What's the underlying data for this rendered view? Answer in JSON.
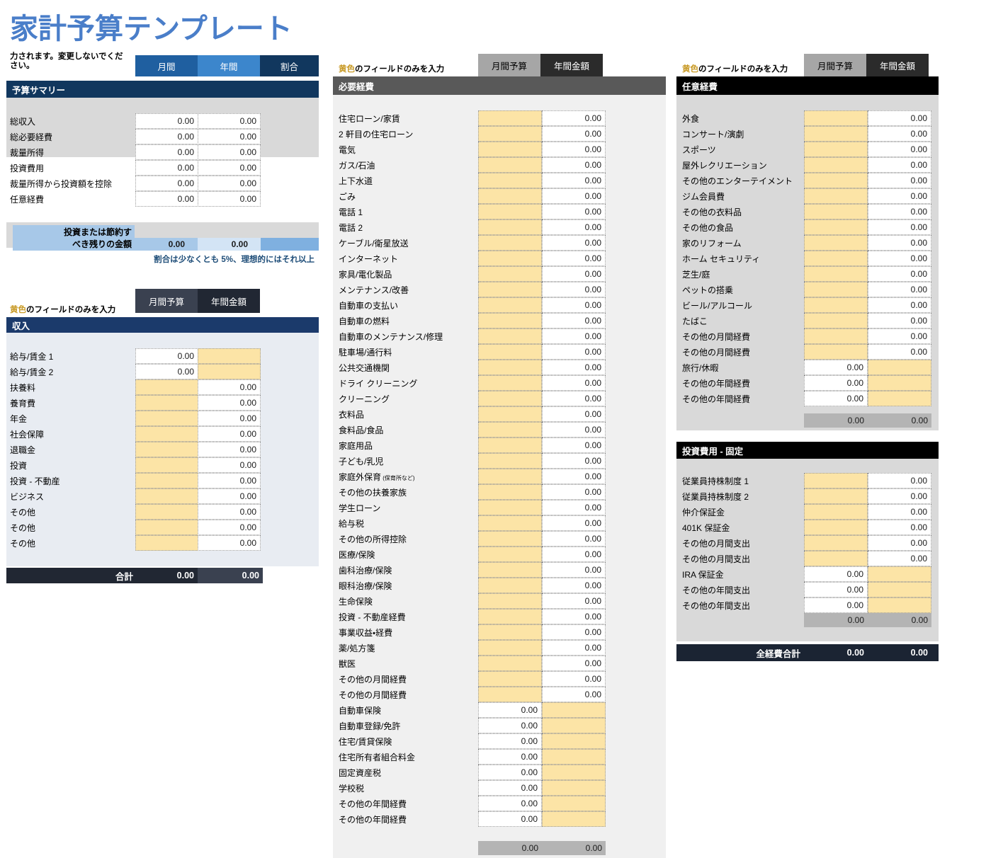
{
  "page": {
    "title": "家計予算テンプレート",
    "title_color": "#4a7ec9"
  },
  "summary": {
    "note": "力されます。変更しないでください。",
    "tabs": [
      {
        "label": "月間",
        "color": "#1f5fa0"
      },
      {
        "label": "年間",
        "color": "#3c86cc"
      },
      {
        "label": "割合",
        "color": "#11375e"
      }
    ],
    "section_title": "予算サマリー",
    "section_color": "#11375e",
    "rows": [
      {
        "label": "総収入",
        "monthly": "0.00",
        "annual": "0.00"
      },
      {
        "label": "総必要経費",
        "monthly": "0.00",
        "annual": "0.00"
      },
      {
        "label": "裁量所得",
        "monthly": "0.00",
        "annual": "0.00"
      },
      {
        "label": "投資費用",
        "monthly": "0.00",
        "annual": "0.00"
      },
      {
        "label": "裁量所得から投資額を控除",
        "monthly": "0.00",
        "annual": "0.00"
      },
      {
        "label": "任意経費",
        "monthly": "0.00",
        "annual": "0.00"
      }
    ],
    "remaining": {
      "label_line1": "投資または節約す",
      "label_line2": "べき残りの金額",
      "monthly": "0.00",
      "annual": "0.00"
    },
    "footnote": "割合は少なくとも 5%、理想的にはそれ以上"
  },
  "income": {
    "note_prefix": "黄色",
    "note_rest": "のフィールドのみを入力",
    "tabs": [
      {
        "label": "月間予算",
        "color": "#3a4150"
      },
      {
        "label": "年間金額",
        "color": "#212733"
      }
    ],
    "section_title": "収入",
    "section_color": "#1b3a6b",
    "rows": [
      {
        "label": "給与/賃金 1",
        "monthly": "0.00",
        "annual": "",
        "monthly_fill": "white",
        "annual_fill": "yellow"
      },
      {
        "label": "給与/賃金 2",
        "monthly": "0.00",
        "annual": "",
        "monthly_fill": "white",
        "annual_fill": "yellow"
      },
      {
        "label": "扶養料",
        "monthly": "",
        "annual": "0.00",
        "monthly_fill": "yellow",
        "annual_fill": "white"
      },
      {
        "label": "養育費",
        "monthly": "",
        "annual": "0.00",
        "monthly_fill": "yellow",
        "annual_fill": "white"
      },
      {
        "label": "年金",
        "monthly": "",
        "annual": "0.00",
        "monthly_fill": "yellow",
        "annual_fill": "white"
      },
      {
        "label": "社会保障",
        "monthly": "",
        "annual": "0.00",
        "monthly_fill": "yellow",
        "annual_fill": "white"
      },
      {
        "label": "退職金",
        "monthly": "",
        "annual": "0.00",
        "monthly_fill": "yellow",
        "annual_fill": "white"
      },
      {
        "label": "投資",
        "monthly": "",
        "annual": "0.00",
        "monthly_fill": "yellow",
        "annual_fill": "white"
      },
      {
        "label": "投資 - 不動産",
        "monthly": "",
        "annual": "0.00",
        "monthly_fill": "yellow",
        "annual_fill": "white"
      },
      {
        "label": "ビジネス",
        "monthly": "",
        "annual": "0.00",
        "monthly_fill": "yellow",
        "annual_fill": "white"
      },
      {
        "label": "その他",
        "monthly": "",
        "annual": "0.00",
        "monthly_fill": "yellow",
        "annual_fill": "white"
      },
      {
        "label": "その他",
        "monthly": "",
        "annual": "0.00",
        "monthly_fill": "yellow",
        "annual_fill": "white"
      },
      {
        "label": "その他",
        "monthly": "",
        "annual": "0.00",
        "monthly_fill": "yellow",
        "annual_fill": "white"
      }
    ],
    "total": {
      "label": "合計",
      "monthly": "0.00",
      "annual": "0.00"
    }
  },
  "necessary": {
    "note_prefix": "黄色",
    "note_rest": "のフィールドのみを入力",
    "tabs": [
      {
        "label": "月間予算",
        "color": "#a6a6a6"
      },
      {
        "label": "年間金額",
        "color": "#2b2b2b"
      }
    ],
    "section_title": "必要経費",
    "section_color": "#595959",
    "rows": [
      {
        "label": "住宅ローン/家賃",
        "monthly": "",
        "annual": "0.00",
        "monthly_fill": "yellow",
        "annual_fill": "white"
      },
      {
        "label": "2 軒目の住宅ローン",
        "monthly": "",
        "annual": "0.00",
        "monthly_fill": "yellow",
        "annual_fill": "white"
      },
      {
        "label": "電気",
        "monthly": "",
        "annual": "0.00",
        "monthly_fill": "yellow",
        "annual_fill": "white"
      },
      {
        "label": "ガス/石油",
        "monthly": "",
        "annual": "0.00",
        "monthly_fill": "yellow",
        "annual_fill": "white"
      },
      {
        "label": "上下水道",
        "monthly": "",
        "annual": "0.00",
        "monthly_fill": "yellow",
        "annual_fill": "white"
      },
      {
        "label": "ごみ",
        "monthly": "",
        "annual": "0.00",
        "monthly_fill": "yellow",
        "annual_fill": "white"
      },
      {
        "label": "電話 1",
        "monthly": "",
        "annual": "0.00",
        "monthly_fill": "yellow",
        "annual_fill": "white"
      },
      {
        "label": "電話 2",
        "monthly": "",
        "annual": "0.00",
        "monthly_fill": "yellow",
        "annual_fill": "white"
      },
      {
        "label": "ケーブル/衛星放送",
        "monthly": "",
        "annual": "0.00",
        "monthly_fill": "yellow",
        "annual_fill": "white"
      },
      {
        "label": "インターネット",
        "monthly": "",
        "annual": "0.00",
        "monthly_fill": "yellow",
        "annual_fill": "white"
      },
      {
        "label": "家具/電化製品",
        "monthly": "",
        "annual": "0.00",
        "monthly_fill": "yellow",
        "annual_fill": "white"
      },
      {
        "label": "メンテナンス/改善",
        "monthly": "",
        "annual": "0.00",
        "monthly_fill": "yellow",
        "annual_fill": "white"
      },
      {
        "label": "自動車の支払い",
        "monthly": "",
        "annual": "0.00",
        "monthly_fill": "yellow",
        "annual_fill": "white"
      },
      {
        "label": "自動車の燃料",
        "monthly": "",
        "annual": "0.00",
        "monthly_fill": "yellow",
        "annual_fill": "white"
      },
      {
        "label": "自動車のメンテナンス/修理",
        "monthly": "",
        "annual": "0.00",
        "monthly_fill": "yellow",
        "annual_fill": "white"
      },
      {
        "label": "駐車場/通行料",
        "monthly": "",
        "annual": "0.00",
        "monthly_fill": "yellow",
        "annual_fill": "white"
      },
      {
        "label": "公共交通機関",
        "monthly": "",
        "annual": "0.00",
        "monthly_fill": "yellow",
        "annual_fill": "white"
      },
      {
        "label": "ドライ クリーニング",
        "monthly": "",
        "annual": "0.00",
        "monthly_fill": "yellow",
        "annual_fill": "white"
      },
      {
        "label": "クリーニング",
        "monthly": "",
        "annual": "0.00",
        "monthly_fill": "yellow",
        "annual_fill": "white"
      },
      {
        "label": "衣料品",
        "monthly": "",
        "annual": "0.00",
        "monthly_fill": "yellow",
        "annual_fill": "white"
      },
      {
        "label": "食料品/食品",
        "monthly": "",
        "annual": "0.00",
        "monthly_fill": "yellow",
        "annual_fill": "white"
      },
      {
        "label": "家庭用品",
        "monthly": "",
        "annual": "0.00",
        "monthly_fill": "yellow",
        "annual_fill": "white"
      },
      {
        "label": "子ども/乳児",
        "monthly": "",
        "annual": "0.00",
        "monthly_fill": "yellow",
        "annual_fill": "white"
      },
      {
        "label": "家庭外保育",
        "label_small": "(保育所など)",
        "monthly": "",
        "annual": "0.00",
        "monthly_fill": "yellow",
        "annual_fill": "white"
      },
      {
        "label": "その他の扶養家族",
        "monthly": "",
        "annual": "0.00",
        "monthly_fill": "yellow",
        "annual_fill": "white"
      },
      {
        "label": "学生ローン",
        "monthly": "",
        "annual": "0.00",
        "monthly_fill": "yellow",
        "annual_fill": "white"
      },
      {
        "label": "給与税",
        "monthly": "",
        "annual": "0.00",
        "monthly_fill": "yellow",
        "annual_fill": "white"
      },
      {
        "label": "その他の所得控除",
        "monthly": "",
        "annual": "0.00",
        "monthly_fill": "yellow",
        "annual_fill": "white"
      },
      {
        "label": "医療/保険",
        "monthly": "",
        "annual": "0.00",
        "monthly_fill": "yellow",
        "annual_fill": "white"
      },
      {
        "label": "歯科治療/保険",
        "monthly": "",
        "annual": "0.00",
        "monthly_fill": "yellow",
        "annual_fill": "white"
      },
      {
        "label": "眼科治療/保険",
        "monthly": "",
        "annual": "0.00",
        "monthly_fill": "yellow",
        "annual_fill": "white"
      },
      {
        "label": "生命保険",
        "monthly": "",
        "annual": "0.00",
        "monthly_fill": "yellow",
        "annual_fill": "white"
      },
      {
        "label": "投資 - 不動産経費",
        "monthly": "",
        "annual": "0.00",
        "monthly_fill": "yellow",
        "annual_fill": "white"
      },
      {
        "label": "事業収益・経費",
        "monthly": "",
        "annual": "0.00",
        "monthly_fill": "yellow",
        "annual_fill": "white"
      },
      {
        "label": "薬/処方箋",
        "monthly": "",
        "annual": "0.00",
        "monthly_fill": "yellow",
        "annual_fill": "white"
      },
      {
        "label": "獣医",
        "monthly": "",
        "annual": "0.00",
        "monthly_fill": "yellow",
        "annual_fill": "white"
      },
      {
        "label": "その他の月間経費",
        "monthly": "",
        "annual": "0.00",
        "monthly_fill": "yellow",
        "annual_fill": "white"
      },
      {
        "label": "その他の月間経費",
        "monthly": "",
        "annual": "0.00",
        "monthly_fill": "yellow",
        "annual_fill": "white"
      },
      {
        "label": "自動車保険",
        "monthly": "0.00",
        "annual": "",
        "monthly_fill": "white",
        "annual_fill": "yellow"
      },
      {
        "label": "自動車登録/免許",
        "monthly": "0.00",
        "annual": "",
        "monthly_fill": "white",
        "annual_fill": "yellow"
      },
      {
        "label": "住宅/賃貸保険",
        "monthly": "0.00",
        "annual": "",
        "monthly_fill": "white",
        "annual_fill": "yellow"
      },
      {
        "label": "住宅所有者組合料金",
        "monthly": "0.00",
        "annual": "",
        "monthly_fill": "white",
        "annual_fill": "yellow"
      },
      {
        "label": "固定資産税",
        "monthly": "0.00",
        "annual": "",
        "monthly_fill": "white",
        "annual_fill": "yellow"
      },
      {
        "label": "学校税",
        "monthly": "0.00",
        "annual": "",
        "monthly_fill": "white",
        "annual_fill": "yellow"
      },
      {
        "label": "その他の年間経費",
        "monthly": "0.00",
        "annual": "",
        "monthly_fill": "white",
        "annual_fill": "yellow"
      },
      {
        "label": "その他の年間経費",
        "monthly": "0.00",
        "annual": "",
        "monthly_fill": "white",
        "annual_fill": "yellow"
      }
    ],
    "total": {
      "monthly": "0.00",
      "annual": "0.00"
    }
  },
  "optional": {
    "note_prefix": "黄色",
    "note_rest": "のフィールドのみを入力",
    "tabs": [
      {
        "label": "月間予算",
        "color": "#a6a6a6"
      },
      {
        "label": "年間金額",
        "color": "#2b2b2b"
      }
    ],
    "section_title": "任意経費",
    "section_color": "#000000",
    "rows": [
      {
        "label": "外食",
        "monthly": "",
        "annual": "0.00",
        "monthly_fill": "yellow",
        "annual_fill": "white"
      },
      {
        "label": "コンサート/演劇",
        "monthly": "",
        "annual": "0.00",
        "monthly_fill": "yellow",
        "annual_fill": "white"
      },
      {
        "label": "スポーツ",
        "monthly": "",
        "annual": "0.00",
        "monthly_fill": "yellow",
        "annual_fill": "white"
      },
      {
        "label": "屋外レクリエーション",
        "monthly": "",
        "annual": "0.00",
        "monthly_fill": "yellow",
        "annual_fill": "white"
      },
      {
        "label": "その他のエンターテイメント",
        "monthly": "",
        "annual": "0.00",
        "monthly_fill": "yellow",
        "annual_fill": "white"
      },
      {
        "label": "ジム会員費",
        "monthly": "",
        "annual": "0.00",
        "monthly_fill": "yellow",
        "annual_fill": "white"
      },
      {
        "label": "その他の衣料品",
        "monthly": "",
        "annual": "0.00",
        "monthly_fill": "yellow",
        "annual_fill": "white"
      },
      {
        "label": "その他の食品",
        "monthly": "",
        "annual": "0.00",
        "monthly_fill": "yellow",
        "annual_fill": "white"
      },
      {
        "label": "家のリフォーム",
        "monthly": "",
        "annual": "0.00",
        "monthly_fill": "yellow",
        "annual_fill": "white"
      },
      {
        "label": "ホーム セキュリティ",
        "monthly": "",
        "annual": "0.00",
        "monthly_fill": "yellow",
        "annual_fill": "white"
      },
      {
        "label": "芝生/庭",
        "monthly": "",
        "annual": "0.00",
        "monthly_fill": "yellow",
        "annual_fill": "white"
      },
      {
        "label": "ペットの搭乗",
        "monthly": "",
        "annual": "0.00",
        "monthly_fill": "yellow",
        "annual_fill": "white"
      },
      {
        "label": "ビール/アルコール",
        "monthly": "",
        "annual": "0.00",
        "monthly_fill": "yellow",
        "annual_fill": "white"
      },
      {
        "label": "たばこ",
        "monthly": "",
        "annual": "0.00",
        "monthly_fill": "yellow",
        "annual_fill": "white"
      },
      {
        "label": "その他の月間経費",
        "monthly": "",
        "annual": "0.00",
        "monthly_fill": "yellow",
        "annual_fill": "white"
      },
      {
        "label": "その他の月間経費",
        "monthly": "",
        "annual": "0.00",
        "monthly_fill": "yellow",
        "annual_fill": "white"
      },
      {
        "label": "旅行/休暇",
        "monthly": "0.00",
        "annual": "",
        "monthly_fill": "white",
        "annual_fill": "yellow"
      },
      {
        "label": "その他の年間経費",
        "monthly": "0.00",
        "annual": "",
        "monthly_fill": "white",
        "annual_fill": "yellow"
      },
      {
        "label": "その他の年間経費",
        "monthly": "0.00",
        "annual": "",
        "monthly_fill": "white",
        "annual_fill": "yellow"
      }
    ],
    "total": {
      "monthly": "0.00",
      "annual": "0.00"
    }
  },
  "investment": {
    "section_title": "投資費用 - 固定",
    "section_color": "#000000",
    "rows": [
      {
        "label": "従業員持株制度 1",
        "monthly": "",
        "annual": "0.00",
        "monthly_fill": "yellow",
        "annual_fill": "white"
      },
      {
        "label": "従業員持株制度 2",
        "monthly": "",
        "annual": "0.00",
        "monthly_fill": "yellow",
        "annual_fill": "white"
      },
      {
        "label": "仲介保証金",
        "monthly": "",
        "annual": "0.00",
        "monthly_fill": "yellow",
        "annual_fill": "white"
      },
      {
        "label": "401K 保証金",
        "monthly": "",
        "annual": "0.00",
        "monthly_fill": "yellow",
        "annual_fill": "white"
      },
      {
        "label": "その他の月間支出",
        "monthly": "",
        "annual": "0.00",
        "monthly_fill": "yellow",
        "annual_fill": "white"
      },
      {
        "label": "その他の月間支出",
        "monthly": "",
        "annual": "0.00",
        "monthly_fill": "yellow",
        "annual_fill": "white"
      },
      {
        "label": "IRA 保証金",
        "monthly": "0.00",
        "annual": "",
        "monthly_fill": "white",
        "annual_fill": "yellow"
      },
      {
        "label": "その他の年間支出",
        "monthly": "0.00",
        "annual": "",
        "monthly_fill": "white",
        "annual_fill": "yellow"
      },
      {
        "label": "その他の年間支出",
        "monthly": "0.00",
        "annual": "",
        "monthly_fill": "white",
        "annual_fill": "yellow"
      }
    ],
    "total": {
      "monthly": "0.00",
      "annual": "0.00"
    }
  },
  "grand_total": {
    "label": "全経費合計",
    "monthly": "0.00",
    "annual": "0.00",
    "color": "#1b2433"
  }
}
